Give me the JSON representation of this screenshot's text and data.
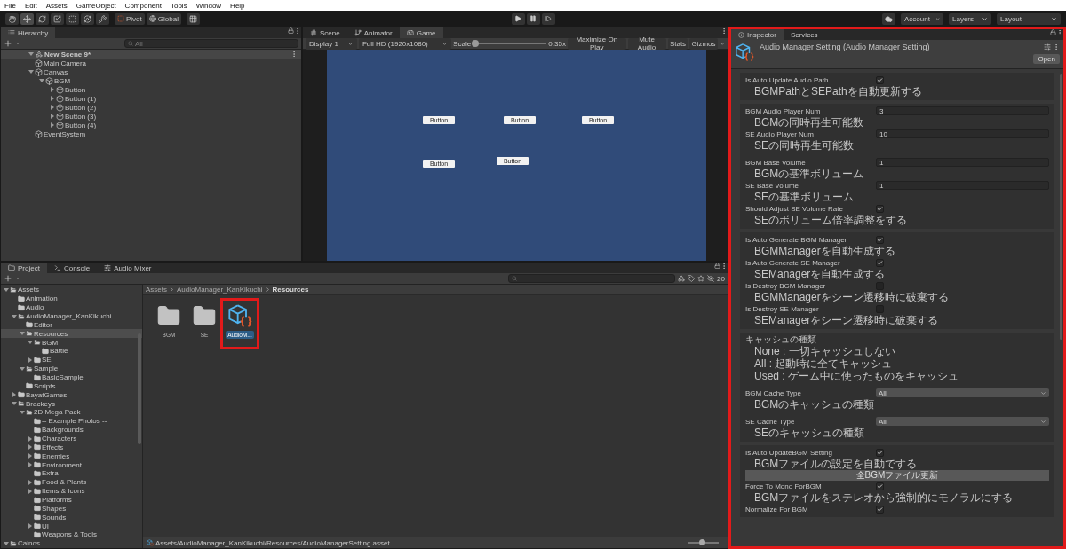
{
  "menu": [
    "File",
    "Edit",
    "Assets",
    "GameObject",
    "Component",
    "Tools",
    "Window",
    "Help"
  ],
  "toolbar": {
    "tools": [
      {
        "kind": "hand",
        "selected": false
      },
      {
        "kind": "move",
        "selected": true
      },
      {
        "kind": "rotate",
        "selected": false
      },
      {
        "kind": "scale",
        "selected": false
      },
      {
        "kind": "rect",
        "selected": false
      },
      {
        "kind": "transform",
        "selected": false
      },
      {
        "kind": "custom",
        "selected": false
      }
    ],
    "pivot": "Pivot",
    "global": "Global",
    "right": [
      "Account",
      "Layers",
      "Layout"
    ]
  },
  "hierarchy": {
    "title": "Hierarchy",
    "search": {
      "placeholder": "All"
    },
    "scene": "New Scene 9*",
    "items": [
      {
        "name": "Main Camera"
      },
      {
        "name": "Canvas",
        "expanded": true,
        "children": [
          {
            "name": "BGM",
            "expanded": true,
            "children": [
              {
                "name": "Button",
                "expanded": false
              },
              {
                "name": "Button (1)",
                "expanded": false
              },
              {
                "name": "Button (2)",
                "expanded": false
              },
              {
                "name": "Button (3)",
                "expanded": false
              },
              {
                "name": "Button (4)",
                "expanded": false
              }
            ]
          }
        ]
      },
      {
        "name": "EventSystem"
      }
    ]
  },
  "game": {
    "tabs": [
      {
        "label": "Scene",
        "kind": "scene",
        "selected": false
      },
      {
        "label": "Animator",
        "kind": "animator",
        "selected": false
      },
      {
        "label": "Game",
        "kind": "game",
        "selected": true
      }
    ],
    "display": "Display 1",
    "resolution": "Full HD (1920x1080)",
    "scale": {
      "label": "Scale",
      "level": 0.04,
      "reading": "0.35x"
    },
    "buttons": [
      "Maximize On Play",
      "Mute Audio",
      "Stats",
      "Gizmos"
    ],
    "ui_buttons": [
      "Button",
      "Button",
      "Button",
      "Button",
      "Button"
    ]
  },
  "project": {
    "tabs": [
      {
        "label": "Project",
        "kind": "project",
        "selected": true
      },
      {
        "label": "Console",
        "kind": "console",
        "selected": false
      },
      {
        "label": "Audio Mixer",
        "kind": "mixer",
        "selected": false
      }
    ],
    "hidden_count": "20",
    "tree": [
      {
        "name": "Assets",
        "expanded": true,
        "selected": false,
        "children": [
          {
            "name": "Animation",
            "selected": false
          },
          {
            "name": "Audio",
            "selected": false
          },
          {
            "name": "AudioManager_KanKikuchi",
            "expanded": true,
            "selected": false,
            "children": [
              {
                "name": "Editor",
                "selected": false
              },
              {
                "name": "Resources",
                "expanded": true,
                "selected": true,
                "children": [
                  {
                    "name": "BGM",
                    "expanded": true,
                    "selected": false,
                    "children": [
                      {
                        "name": "Battle",
                        "selected": false
                      }
                    ]
                  },
                  {
                    "name": "SE",
                    "expanded": false,
                    "selected": false
                  }
                ]
              },
              {
                "name": "Sample",
                "expanded": true,
                "selected": false,
                "children": [
                  {
                    "name": "BasicSample",
                    "selected": false
                  }
                ]
              },
              {
                "name": "Scripts",
                "selected": false
              }
            ]
          },
          {
            "name": "BayatGames",
            "expanded": false,
            "selected": false
          },
          {
            "name": "Brackeys",
            "expanded": true,
            "selected": false,
            "children": [
              {
                "name": "2D Mega Pack",
                "expanded": true,
                "selected": false,
                "children": [
                  {
                    "name": "-- Example Photos --",
                    "selected": false
                  },
                  {
                    "name": "Backgrounds",
                    "selected": false
                  },
                  {
                    "name": "Characters",
                    "expanded": false,
                    "selected": false
                  },
                  {
                    "name": "Effects",
                    "expanded": false,
                    "selected": false
                  },
                  {
                    "name": "Enemies",
                    "expanded": false,
                    "selected": false
                  },
                  {
                    "name": "Environment",
                    "expanded": false,
                    "selected": false
                  },
                  {
                    "name": "Extra",
                    "selected": false
                  },
                  {
                    "name": "Food & Plants",
                    "expanded": false,
                    "selected": false
                  },
                  {
                    "name": "Items & Icons",
                    "expanded": false,
                    "selected": false
                  },
                  {
                    "name": "Platforms",
                    "selected": false
                  },
                  {
                    "name": "Shapes",
                    "selected": false
                  },
                  {
                    "name": "Sounds",
                    "selected": false
                  },
                  {
                    "name": "UI",
                    "expanded": false,
                    "selected": false
                  },
                  {
                    "name": "Weapons & Tools",
                    "selected": false
                  }
                ]
              }
            ]
          }
        ]
      },
      {
        "name": "Cainos",
        "expanded": true,
        "selected": false
      }
    ],
    "breadcrumb": [
      "Assets",
      "AudioManager_KanKikuchi",
      "Resources"
    ],
    "items": [
      {
        "name": "BGM",
        "kind": "folder",
        "selected": false,
        "annotated": false
      },
      {
        "name": "SE",
        "kind": "folder",
        "selected": false,
        "annotated": false
      },
      {
        "name": "AudioM...",
        "kind": "asset",
        "selected": true,
        "annotated": true
      }
    ],
    "zoom": {
      "level": 0.45
    },
    "status_path": "Assets/AudioManager_KanKikuchi/Resources/AudioManagerSetting.asset"
  },
  "inspector": {
    "annotated": true,
    "tabs": [
      {
        "label": "Inspector",
        "selected": true
      },
      {
        "label": "Services",
        "selected": false
      }
    ],
    "title": "Audio Manager Setting (Audio Manager Setting)",
    "open_button": "Open",
    "sections": [
      {
        "groups": [
          [
            {
              "kind": "checkbox",
              "label": "Is Auto Update Audio Path",
              "checked": true,
              "hint": "BGMPathとSEPathを自動更新する"
            }
          ]
        ]
      },
      {
        "groups": [
          [
            {
              "kind": "number",
              "label": "BGM Audio Player Num",
              "value": "3",
              "hint": "BGMの同時再生可能数"
            },
            {
              "kind": "number",
              "label": "SE Audio Player Num",
              "value": "10",
              "hint": "SEの同時再生可能数"
            }
          ],
          [
            {
              "kind": "number",
              "label": "BGM Base Volume",
              "value": "1",
              "hint": "BGMの基準ボリューム"
            },
            {
              "kind": "number",
              "label": "SE Base Volume",
              "value": "1",
              "hint": "SEの基準ボリューム"
            },
            {
              "kind": "checkbox",
              "label": "Should Adjust SE Volume Rate",
              "checked": true,
              "hint": "SEのボリューム倍率調整をする"
            }
          ]
        ]
      },
      {
        "groups": [
          [
            {
              "kind": "checkbox",
              "label": "Is Auto Generate BGM Manager",
              "checked": true,
              "hint": "BGMManagerを自動生成する"
            },
            {
              "kind": "checkbox",
              "label": "Is Auto Generate SE Manager",
              "checked": true,
              "hint": "SEManagerを自動生成する"
            },
            {
              "kind": "checkbox",
              "label": "Is Destroy BGM Manager",
              "checked": false,
              "hint": "BGMManagerをシーン遷移時に破棄する"
            },
            {
              "kind": "checkbox",
              "label": "Is Destroy SE Manager",
              "checked": false,
              "hint": "SEManagerをシーン遷移時に破棄する"
            }
          ]
        ]
      },
      {
        "groups": [
          [
            {
              "kind": "note",
              "label": "キャッシュの種類",
              "lines": [
                "None : 一切キャッシュしない",
                "All : 起動時に全てキャッシュ",
                "Used : ゲーム中に使ったものをキャッシュ"
              ]
            }
          ],
          [
            {
              "kind": "dropdown",
              "label": "BGM Cache Type",
              "value": "All",
              "hint": "BGMのキャッシュの種類"
            }
          ],
          [
            {
              "kind": "dropdown",
              "label": "SE Cache Type",
              "value": "All",
              "hint": "SEのキャッシュの種類"
            }
          ]
        ]
      },
      {
        "groups": [
          [
            {
              "kind": "checkbox",
              "label": "Is Auto UpdateBGM Setting",
              "checked": true,
              "hint": "BGMファイルの設定を自動でする"
            },
            {
              "kind": "button",
              "label": "全BGMファイル更新"
            },
            {
              "kind": "checkbox",
              "label": "Force To Mono ForBGM",
              "checked": true,
              "hint": "BGMファイルをステレオから強制的にモノラルにする"
            },
            {
              "kind": "checkbox",
              "label": "Normalize For BGM",
              "checked": true
            }
          ]
        ]
      }
    ]
  }
}
